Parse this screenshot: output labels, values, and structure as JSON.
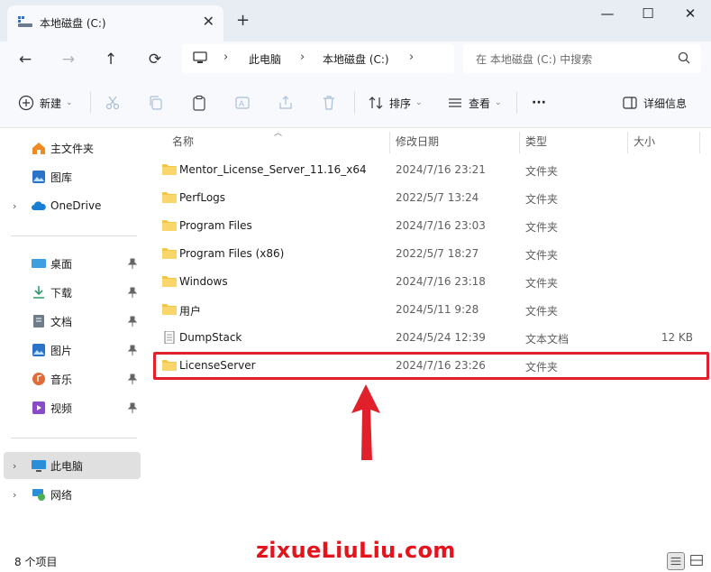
{
  "window": {
    "tab_title": "本地磁盘 (C:)",
    "new_tab": "+",
    "minimize": "—",
    "maximize": "☐",
    "close": "✕"
  },
  "address": {
    "crumbs": [
      "此电脑",
      "本地磁盘 (C:)"
    ],
    "search_placeholder": "在 本地磁盘 (C:) 中搜索"
  },
  "toolbar": {
    "new_label": "新建",
    "sort_label": "排序",
    "view_label": "查看",
    "more_label": "···",
    "details_label": "详细信息"
  },
  "sidebar": {
    "items": [
      {
        "label": "主文件夹",
        "icon": "home-icon"
      },
      {
        "label": "图库",
        "icon": "gallery-icon"
      },
      {
        "label": "OneDrive",
        "icon": "cloud-icon"
      },
      {
        "label": "桌面",
        "icon": "desktop-icon"
      },
      {
        "label": "下载",
        "icon": "download-icon"
      },
      {
        "label": "文档",
        "icon": "document-icon"
      },
      {
        "label": "图片",
        "icon": "pictures-icon"
      },
      {
        "label": "音乐",
        "icon": "music-icon"
      },
      {
        "label": "视频",
        "icon": "video-icon"
      },
      {
        "label": "此电脑",
        "icon": "pc-icon"
      },
      {
        "label": "网络",
        "icon": "network-icon"
      }
    ]
  },
  "columns": {
    "name": "名称",
    "date": "修改日期",
    "type": "类型",
    "size": "大小"
  },
  "files": [
    {
      "name": "Mentor_License_Server_11.16_x64",
      "date": "2024/7/16 23:21",
      "type": "文件夹",
      "size": "",
      "kind": "folder"
    },
    {
      "name": "PerfLogs",
      "date": "2022/5/7 13:24",
      "type": "文件夹",
      "size": "",
      "kind": "folder"
    },
    {
      "name": "Program Files",
      "date": "2024/7/16 23:03",
      "type": "文件夹",
      "size": "",
      "kind": "folder"
    },
    {
      "name": "Program Files (x86)",
      "date": "2022/5/7 18:27",
      "type": "文件夹",
      "size": "",
      "kind": "folder"
    },
    {
      "name": "Windows",
      "date": "2024/7/16 23:18",
      "type": "文件夹",
      "size": "",
      "kind": "folder"
    },
    {
      "name": "用户",
      "date": "2024/5/11 9:28",
      "type": "文件夹",
      "size": "",
      "kind": "folder"
    },
    {
      "name": "DumpStack",
      "date": "2024/5/24 12:39",
      "type": "文本文档",
      "size": "12 KB",
      "kind": "text"
    },
    {
      "name": "LicenseServer",
      "date": "2024/7/16 23:26",
      "type": "文件夹",
      "size": "",
      "kind": "folder"
    }
  ],
  "status": {
    "count": "8 个项目",
    "watermark": "zixueLiuLiu.com"
  },
  "colors": {
    "highlight": "#e0202b",
    "folder": "#f4c542",
    "accent": "#0067c0"
  }
}
